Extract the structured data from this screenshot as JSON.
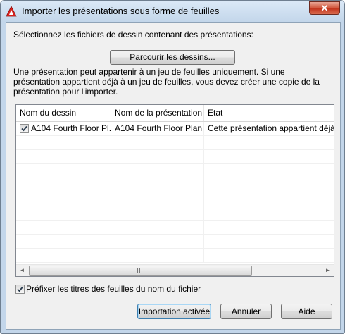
{
  "window": {
    "title": "Importer les présentations sous forme de feuilles",
    "close_glyph": "✕"
  },
  "select_label": "Sélectionnez les fichiers de dessin contenant des présentations:",
  "browse_button": "Parcourir les dessins...",
  "info_text": "Une présentation peut appartenir à un jeu de feuilles uniquement. Si une présentation appartient déjà à un jeu de feuilles, vous devez créer une copie de la présentation pour l'importer.",
  "table": {
    "columns": [
      "Nom du dessin",
      "Nom de la présentation",
      "Etat"
    ],
    "rows": [
      {
        "checked": true,
        "drawing": "A104 Fourth Floor Pl...",
        "layout": "A104 Fourth Floor Plan",
        "status": "Cette présentation appartient déjà à"
      }
    ]
  },
  "scroll": {
    "left_glyph": "◄",
    "right_glyph": "►"
  },
  "prefix_option": {
    "checked": true,
    "label": "Préfixer les titres des feuilles du nom du fichier"
  },
  "buttons": {
    "import": "Importation activée",
    "cancel": "Annuler",
    "help": "Aide"
  },
  "icons": {
    "app": "autocad-logo-icon",
    "close": "close-icon",
    "check": "checkmark-icon"
  },
  "colors": {
    "close_red": "#c1321b",
    "app_red": "#d8211d",
    "default_button_border": "#3c7fb1"
  }
}
